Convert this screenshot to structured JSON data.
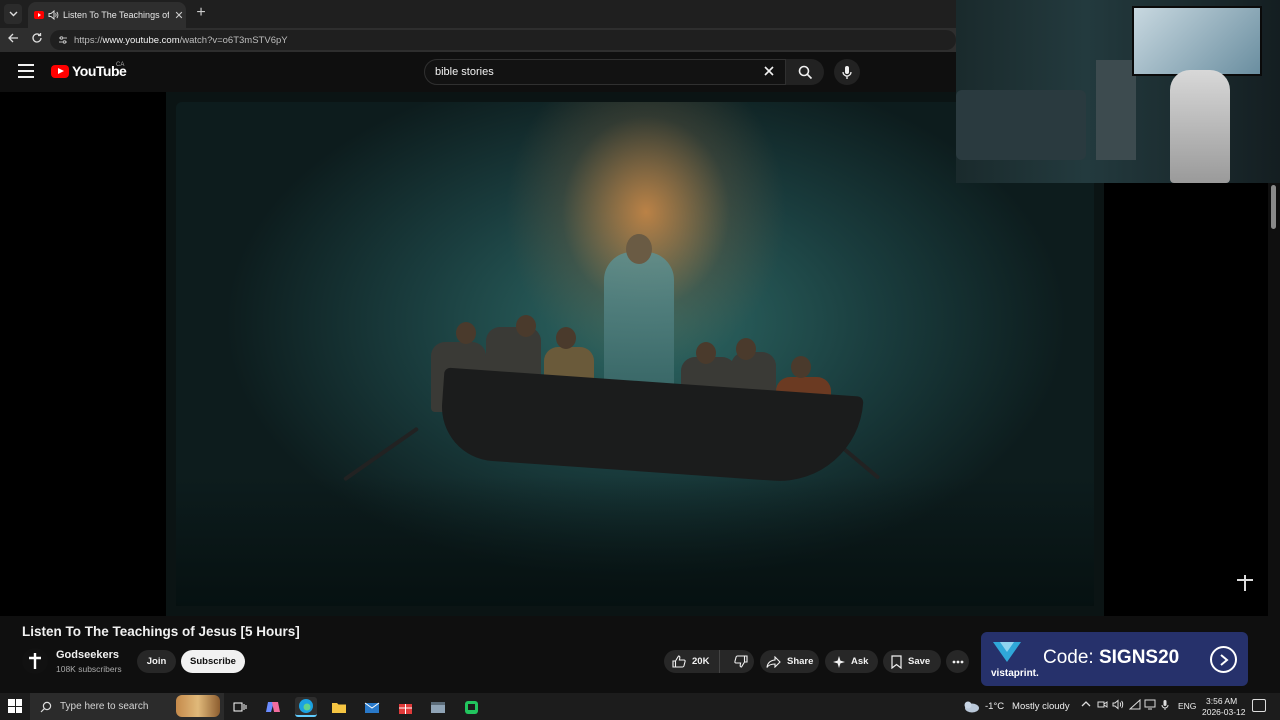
{
  "browser": {
    "tab_title": "Listen To The Teachings of Jesus",
    "tab_close": "✕",
    "new_tab": "+",
    "url_prefix": "https://",
    "url_host": "www.youtube.com",
    "url_path": "/watch?v=o6T3mSTV6pY"
  },
  "youtube": {
    "logo_text": "YouTube",
    "country": "CA",
    "search_value": "bible stories"
  },
  "video": {
    "title": "Listen To The Teachings of Jesus [5 Hours]",
    "channel_name": "Godseekers",
    "channel_subscribers": "108K subscribers",
    "join_label": "Join",
    "subscribe_label": "Subscribe",
    "like_count": "20K",
    "share_label": "Share",
    "ask_label": "Ask",
    "save_label": "Save"
  },
  "ad": {
    "brand": "vistaprint.",
    "code_prefix": "Code: ",
    "code_value": "SIGNS20",
    "background_color": "#26316b"
  },
  "taskbar": {
    "search_placeholder": "Type here to search",
    "weather_temp": "-1°C",
    "weather_desc": "Mostly cloudy",
    "language": "ENG",
    "time": "3:56 AM",
    "date": "2026-03-12"
  },
  "colors": {
    "youtube_red": "#ff0000",
    "background": "#0f0f0f",
    "taskbar_accent": "#60cdff"
  }
}
